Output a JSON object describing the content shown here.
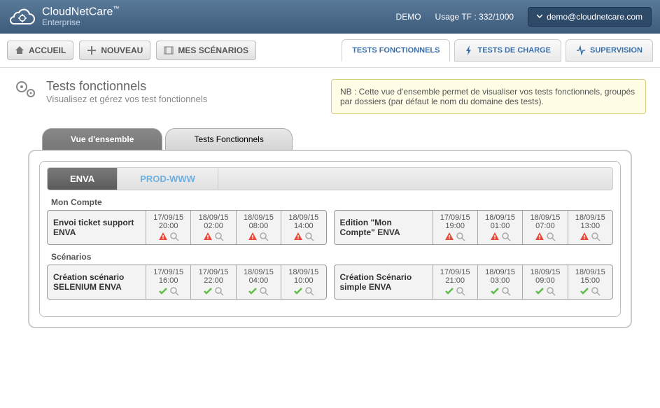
{
  "brand": {
    "name": "CloudNetCare",
    "tm": "™",
    "edition": "Enterprise"
  },
  "header": {
    "demo": "DEMO",
    "usage_label": "Usage TF : 332/1000",
    "user": "demo@cloudnetcare.com"
  },
  "nav": {
    "home": "ACCUEIL",
    "new": "NOUVEAU",
    "scenarios": "MES SCÉNARIOS",
    "functional": "TESTS FONCTIONNELS",
    "load": "TESTS DE CHARGE",
    "supervision": "SUPERVISION"
  },
  "page": {
    "title": "Tests fonctionnels",
    "subtitle": "Visualisez et gérez vos test fonctionnels",
    "note": "NB : Cette vue d'ensemble permet de visualiser vos tests fonctionnels, groupés par dossiers (par défaut le nom du domaine des tests)."
  },
  "subtabs": {
    "overview": "Vue d'ensemble",
    "tests": "Tests Fonctionnels"
  },
  "folders": {
    "enva": "ENVA",
    "prod": "PROD-WWW"
  },
  "sections": {
    "compte": "Mon Compte",
    "scenarios": "Scénarios"
  },
  "tests": {
    "t1": {
      "name": "Envoi ticket support ENVA",
      "slots": [
        {
          "date": "17/09/15",
          "time": "20:00",
          "status": "fail"
        },
        {
          "date": "18/09/15",
          "time": "02:00",
          "status": "fail"
        },
        {
          "date": "18/09/15",
          "time": "08:00",
          "status": "fail"
        },
        {
          "date": "18/09/15",
          "time": "14:00",
          "status": "fail"
        }
      ]
    },
    "t2": {
      "name": "Edition \"Mon Compte\" ENVA",
      "slots": [
        {
          "date": "17/09/15",
          "time": "19:00",
          "status": "fail"
        },
        {
          "date": "18/09/15",
          "time": "01:00",
          "status": "fail"
        },
        {
          "date": "18/09/15",
          "time": "07:00",
          "status": "fail"
        },
        {
          "date": "18/09/15",
          "time": "13:00",
          "status": "fail"
        }
      ]
    },
    "t3": {
      "name": "Création scénario SELENIUM ENVA",
      "slots": [
        {
          "date": "17/09/15",
          "time": "16:00",
          "status": "pass"
        },
        {
          "date": "17/09/15",
          "time": "22:00",
          "status": "pass"
        },
        {
          "date": "18/09/15",
          "time": "04:00",
          "status": "pass"
        },
        {
          "date": "18/09/15",
          "time": "10:00",
          "status": "pass"
        }
      ]
    },
    "t4": {
      "name": "Création Scénario simple ENVA",
      "slots": [
        {
          "date": "17/09/15",
          "time": "21:00",
          "status": "pass"
        },
        {
          "date": "18/09/15",
          "time": "03:00",
          "status": "pass"
        },
        {
          "date": "18/09/15",
          "time": "09:00",
          "status": "pass"
        },
        {
          "date": "18/09/15",
          "time": "15:00",
          "status": "pass"
        }
      ]
    }
  }
}
